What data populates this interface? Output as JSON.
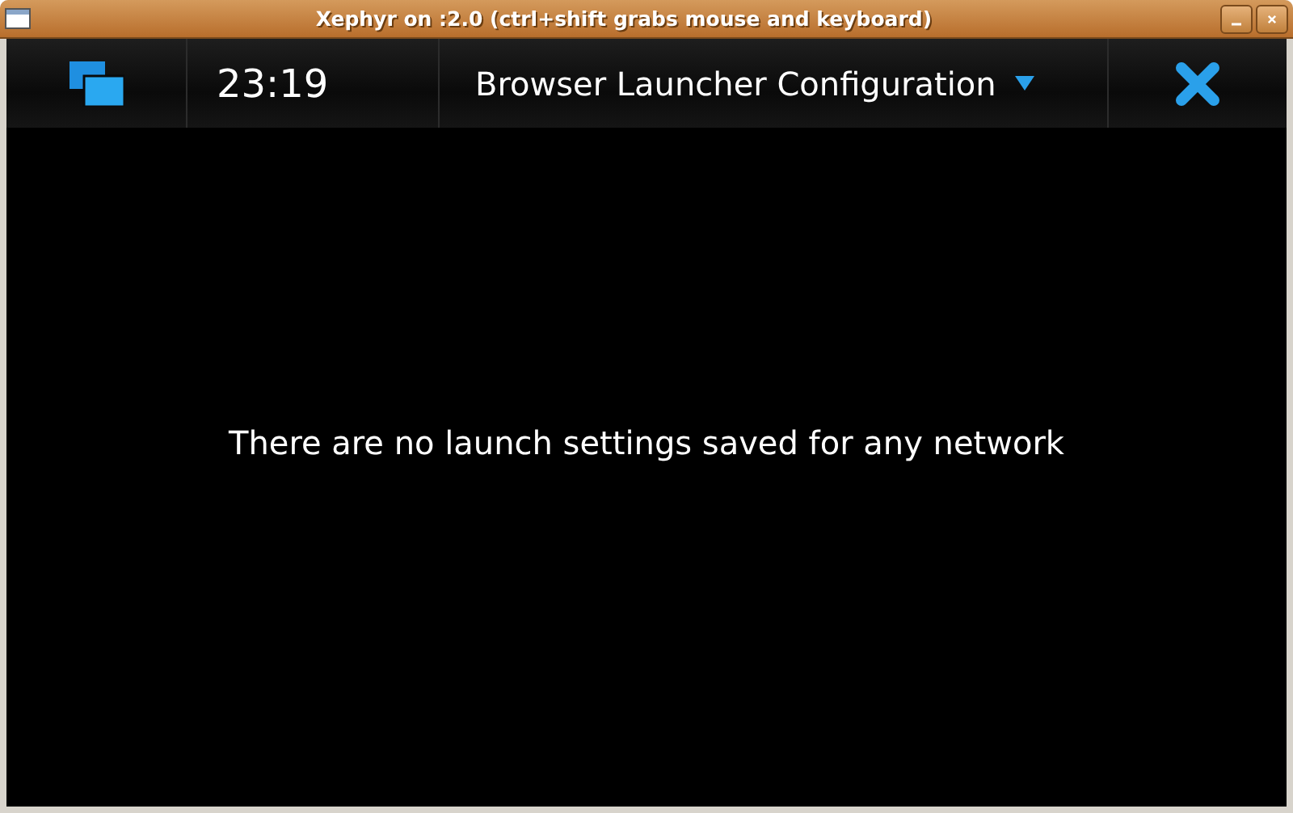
{
  "window": {
    "title": "Xephyr on :2.0 (ctrl+shift grabs mouse and keyboard)"
  },
  "header": {
    "time": "23:19",
    "title": "Browser Launcher Configuration"
  },
  "message": "There are no launch settings saved for any network"
}
